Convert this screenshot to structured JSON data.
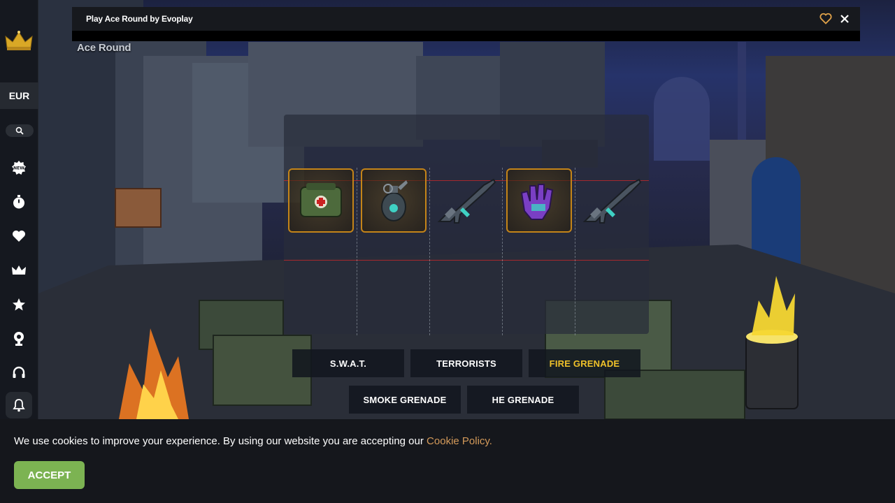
{
  "sidebar": {
    "currency": "EUR",
    "icons": [
      "crown-logo",
      "search-icon",
      "new-badge-icon",
      "stopwatch-icon",
      "heart-icon",
      "crown-icon",
      "star-icon",
      "trophy-icon",
      "headset-icon",
      "bell-icon"
    ],
    "new_badge": "NEW"
  },
  "game_window": {
    "title": "Play Ace Round by Evoplay",
    "game_label": "Ace Round",
    "accent": "#c48418"
  },
  "game": {
    "symbols": [
      "medkit",
      "frag-grenade",
      "assault-rifle",
      "tactical-gloves",
      "assault-rifle"
    ],
    "bet_options": [
      {
        "label": "S.W.A.T."
      },
      {
        "label": "TERRORISTS"
      },
      {
        "label": "FIRE GRENADE",
        "selected": true
      },
      {
        "label": "SMOKE GRENADE"
      },
      {
        "label": "HE GRENADE"
      }
    ],
    "highlight_color": "#f0c22a"
  },
  "cookie": {
    "text": "We use cookies to improve your experience. By using our website you are accepting our ",
    "link": "Cookie Policy.",
    "accept": "ACCEPT",
    "accept_color": "#7cb352"
  }
}
